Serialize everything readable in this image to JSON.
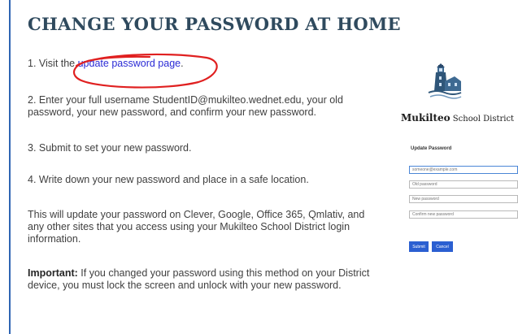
{
  "heading": "CHANGE YOUR PASSWORD AT HOME",
  "steps": {
    "s1_prefix": "1. Visit the ",
    "s1_link": "update password page",
    "s1_suffix": ".",
    "s2": "2. Enter your full username StudentID@mukilteo.wednet.edu, your old password, your new password, and confirm your new password.",
    "s3": "3. Submit to set your new password.",
    "s4": "4. Write down your new password and place in a safe location.",
    "note": "This will update your password on Clever, Google, Office 365, Qmlativ, and any other sites that you access using your Mukilteo School District login information.",
    "important_label": "Important:",
    "important_text": " If you changed your password using this method on your District device, you must lock the screen and unlock with your new password."
  },
  "panel": {
    "district_bold": "Mukilteo",
    "district_rest": " School District",
    "form_title": "Update Password",
    "placeholders": {
      "email": "someone@example.com",
      "old": "Old password",
      "new": "New password",
      "confirm": "Confirm new password"
    },
    "submit_label": "Submit",
    "cancel_label": "Cancel"
  },
  "colors": {
    "heading": "#2f4a5e",
    "link": "#2b2bd6",
    "annotation_circle": "#e02020",
    "frame_border": "#2f65b3",
    "button": "#2b5fd1"
  },
  "icons": {
    "logo": "lighthouse-logo-icon",
    "annotation": "red-hand-drawn-circle"
  }
}
